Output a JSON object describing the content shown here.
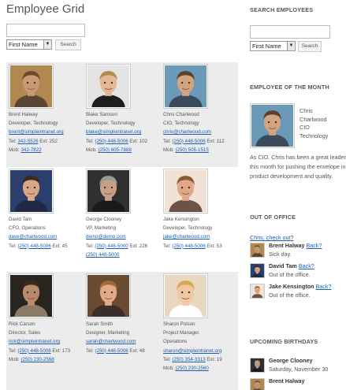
{
  "main": {
    "title": "Employee Grid",
    "search": {
      "select_value": "First Name",
      "button_label": "Search"
    }
  },
  "employees": [
    {
      "name": "Brent Halway",
      "title": "Developer, Technology",
      "email": "brent@simpleintranet.org",
      "tel_prefix": "Tel: ",
      "tel": "342-5526",
      "tel_ext": " Ext: 252",
      "mob_prefix": "Mob: ",
      "mob": "342-7822",
      "skin": "#c99a74",
      "hair": "#6e4a2a",
      "shirt": "#5a4632",
      "bg": "#b08850"
    },
    {
      "name": "Blake Samson",
      "title": "Developer, Technology",
      "email": "blake@simpleintranet.org",
      "tel_prefix": "Tel: ",
      "tel": "(250) 448-5006",
      "tel_ext": " Ext: 102",
      "mob_prefix": "Mob: ",
      "mob": "(250) 605-7888",
      "skin": "#e2b896",
      "hair": "#b88a4e",
      "shirt": "#1e1e1e",
      "bg": "#e4e4e4"
    },
    {
      "name": "Chris Charlwood",
      "title": "CIO, Technology",
      "email": "chris@charlwood.com",
      "tel_prefix": "Tel: ",
      "tel": "(250) 448-5006",
      "tel_ext": " Ext: 112",
      "mob_prefix": "Mob: ",
      "mob": "(250) 505-1515",
      "skin": "#d4a482",
      "hair": "#5a4030",
      "shirt": "#3a4a5a",
      "bg": "#6a9ab8"
    },
    {
      "name": "David Tam",
      "title": "CFO, Operations",
      "email": "dave@charlwood.com",
      "tel_prefix": "Tel: ",
      "tel": "(250) 448-5006",
      "tel_ext": " Ext: 45",
      "mob_prefix": "",
      "mob": "",
      "skin": "#d8a884",
      "hair": "#3a2a1e",
      "shirt": "#1e2a44",
      "bg": "#2a3e70"
    },
    {
      "name": "George Clooney",
      "title": "VP, Marketing",
      "email": "demo@demo.com",
      "tel_prefix": "Tel: ",
      "tel": "(250) 448-5000",
      "tel_ext": " Ext: 226",
      "mob_prefix": "",
      "mob": "(250) 448-5000",
      "skin": "#c8a088",
      "hair": "#9a9a9a",
      "shirt": "#1a1a1a",
      "bg": "#303030"
    },
    {
      "name": "Jake Kensington",
      "title": "Developer, Technology",
      "email": "jake@charlwood.com",
      "tel_prefix": "Tel: ",
      "tel": "(250) 448-5006",
      "tel_ext": " Ext: 53",
      "mob_prefix": "",
      "mob": "",
      "skin": "#e0a888",
      "hair": "#8a5a3a",
      "shirt": "#6a5448",
      "bg": "#f2e2d6"
    },
    {
      "name": "Rick Carson",
      "title": "Director, Sales",
      "email": "rick@simpleintranet.org",
      "tel_prefix": "Tel: ",
      "tel": "(250) 448-5008",
      "tel_ext": " Ext: 173",
      "mob_prefix": "Mob: ",
      "mob": "(250) 230-2568",
      "skin": "#b88a6a",
      "hair": "#3a2a1e",
      "shirt": "#8a7a6a",
      "bg": "#2a241e"
    },
    {
      "name": "Sarah Smith",
      "title": "Designer, Marketing",
      "email": "sarah@charlwood.com",
      "tel_prefix": "Tel: ",
      "tel": "(250) 448-5006",
      "tel_ext": " Ext: 48",
      "mob_prefix": "",
      "mob": "",
      "skin": "#e0aa84",
      "hair": "#a06a3a",
      "shirt": "#3a2e2a",
      "bg": "#6a4a30"
    },
    {
      "name": "Sharon Polson",
      "title": "Project Manager, Operations",
      "title_line1": "Project Manager,",
      "title_line2": "Operations",
      "email": "sharon@simpleintranet.org",
      "tel_prefix": "Tel: ",
      "tel": "(250) 354-3313",
      "tel_ext": " Ext: 19",
      "mob_prefix": "Mob: ",
      "mob": "(250) 230-2560",
      "skin": "#f0c8a0",
      "hair": "#d8a850",
      "shirt": "#ffffff",
      "bg": "#e8d8c0"
    }
  ],
  "sidebar": {
    "search_heading": "SEARCH EMPLOYEES",
    "search": {
      "select_value": "First Name",
      "button_label": "Search"
    },
    "eotm_heading": "EMPLOYEE OF THE MONTH",
    "eotm": {
      "name_line1": "Chris",
      "name_line2": "Charlwood",
      "name_line3": "CIO",
      "name_line4": "Technology",
      "description": "As CIO, Chris has been a great leader this month for pushing the envelope in product development and quality."
    },
    "ooo_heading": "OUT OF OFFICE",
    "ooo_prompt": "Chris, check out?",
    "ooo": [
      {
        "name": "Brent Halway",
        "link": "Back?",
        "status": "Sick day."
      },
      {
        "name": "David Tam",
        "link": "Back?",
        "status": "Out of the office."
      },
      {
        "name": "Jake Kensington",
        "link": "Back?",
        "status": "Out of the office."
      }
    ],
    "bday_heading": "UPCOMING BIRTHDAYS",
    "birthdays": [
      {
        "name": "George Clooney",
        "date": "Saturday, November 30"
      },
      {
        "name": "Brent Halway",
        "date": ""
      }
    ]
  },
  "colors": {
    "link": "#1a5fb4",
    "grid_shade": "#ececec",
    "text": "#555555"
  }
}
